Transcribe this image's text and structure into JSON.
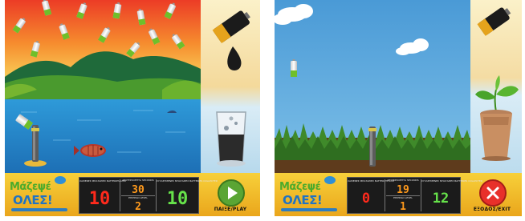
{
  "left_screen": {
    "scene": "lake-sunset",
    "logo": {
      "line1": "Μάζεψέ",
      "line2": "ΟΛΕΣ!"
    },
    "stats": {
      "lost_label": "ΧΑΜΕΝΕΣ ΜΠΑΤΑΡΙΕΣ\nBATTERIES LOST",
      "lost": "10",
      "seconds_label": "ΔΕΥΤΕΡΟΛΕΠΤΑ\nSECONDS",
      "seconds": "30",
      "level_label": "ΕΠΙΠΕΔΟ\nLEVEL",
      "level": "2",
      "collected_label": "ΣΥΛΛΕΓΜΕΝΕΣ ΜΠΑΤΑΡΙΕΣ\nBATTERIES COLLECTED",
      "collected": "10"
    },
    "action_button": {
      "label": "ΠΑΙΞΕ/PLAY",
      "icon": "play-icon"
    }
  },
  "right_screen": {
    "scene": "grass-field",
    "logo": {
      "line1": "Μάζεψέ",
      "line2": "ΟΛΕΣ!"
    },
    "stats": {
      "lost_label": "ΧΑΜΕΝΕΣ ΜΠΑΤΑΡΙΕΣ\nBATTERIES LOST",
      "lost": "0",
      "seconds_label": "ΔΕΥΤΕΡΟΛΕΠΤΑ\nSECONDS",
      "seconds": "19",
      "level_label": "ΕΠΙΠΕΔΟ\nLEVEL",
      "level": "1",
      "collected_label": "ΣΥΛΛΕΓΜΕΝΕΣ ΜΠΑΤΑΡΙΕΣ\nBATTERIES COLLECTED",
      "collected": "12"
    },
    "action_button": {
      "label": "ΕΞΟΔΟΣ/EXIT",
      "icon": "close-icon"
    }
  },
  "colors": {
    "hud_yellow": "#f2c232",
    "digit_red": "#ff2a1c",
    "digit_orange": "#ff9a1c",
    "digit_green": "#66e24a",
    "play_green": "#5aa534",
    "exit_red": "#e8302a"
  }
}
